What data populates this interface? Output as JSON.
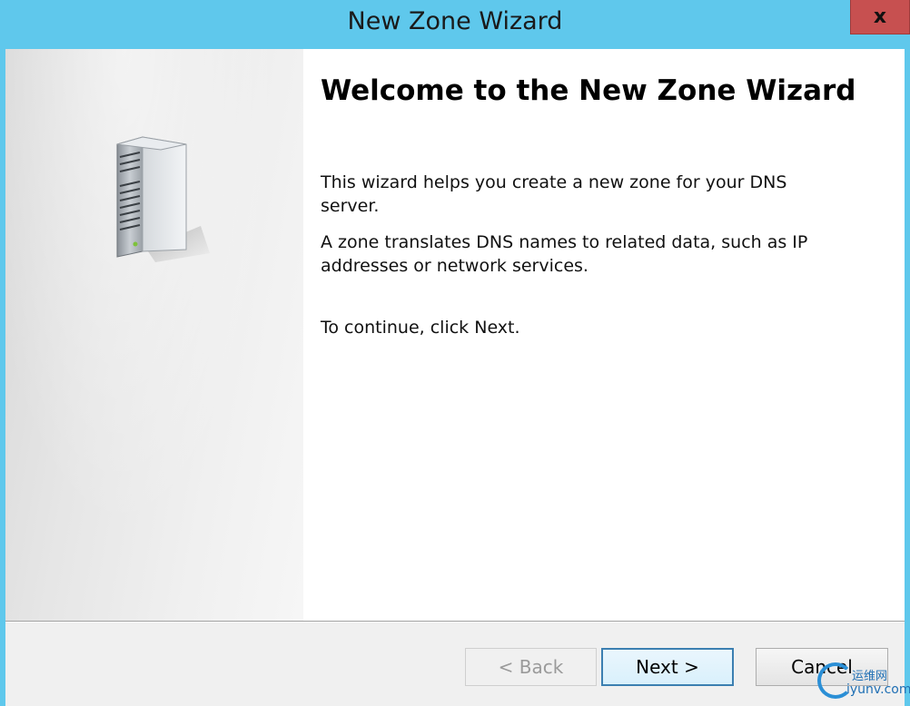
{
  "window": {
    "title": "New Zone Wizard",
    "close_label": "x"
  },
  "main": {
    "heading": "Welcome to the New Zone Wizard",
    "paragraph1": "This wizard helps you create a new zone for your DNS server.",
    "paragraph2": "A zone translates DNS names to related data, such as IP addresses or network services.",
    "paragraph3": "To continue, click Next."
  },
  "buttons": {
    "back_label": "< Back",
    "back_enabled": false,
    "next_label": "Next >",
    "cancel_label": "Cancel"
  },
  "watermark": {
    "text_cn": "运维网",
    "url": "iyunv.com"
  },
  "icons": [
    "close-icon",
    "server-icon"
  ],
  "colors": {
    "titlebar": "#5fc8ec",
    "close_button": "#c75050",
    "default_button_border": "#3c7fb1"
  }
}
